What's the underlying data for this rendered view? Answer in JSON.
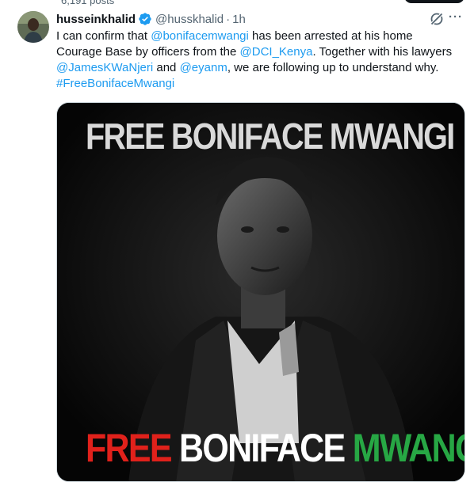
{
  "top": {
    "post_count": "6,191 posts"
  },
  "tweet": {
    "author_name": "husseinkhalid",
    "handle": "@husskhalid",
    "separator": "·",
    "time": "1h",
    "verified_icon": "verified-badge-icon",
    "text": {
      "line1_a": "I can confirm that ",
      "mention1": "@bonifacemwangi",
      "line1_b": " has been arrested at his home",
      "line2_a": "Courage Base by officers from the ",
      "mention2": "@DCI_Kenya",
      "line2_b": ". Together with his lawyers",
      "mention3": "@JamesKWaNjeri",
      "line3_a": " and ",
      "mention4": "@eyanm",
      "line3_b": ", we are following up to understand why.",
      "hashtag": "#FreeBonifaceMwangi"
    }
  },
  "media": {
    "title_top": "FREE BONIFACE MWANGI",
    "bottom_word1": "FREE",
    "bottom_word2": "BONIFACE",
    "bottom_word3": "MWANGI",
    "colors": {
      "red": "#e0211b",
      "white": "#ffffff",
      "green": "#27a744"
    }
  },
  "colors": {
    "link": "#1d9bf0",
    "secondary_text": "#536471",
    "primary_text": "#0f1419"
  }
}
